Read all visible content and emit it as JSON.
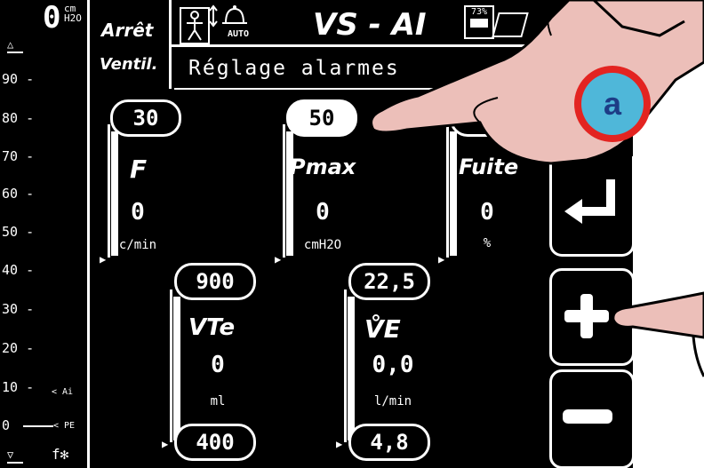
{
  "scale": {
    "top_value": "0",
    "unit": "cm H2O",
    "ticks": [
      "90 -",
      "80 -",
      "70 -",
      "60 -",
      "50 -",
      "40 -",
      "30 -",
      "20 -",
      "10 -",
      "0"
    ],
    "marker_ai": "< Ai",
    "marker_pe": "< PE"
  },
  "header": {
    "stop_line1": "Arrêt",
    "stop_line2": "Ventil.",
    "auto_label": "AUTO",
    "mode": "VS - AI",
    "battery_percent": "73%",
    "subtitle": "Réglage alarmes"
  },
  "params": [
    {
      "name": "F",
      "setting": "30",
      "value": "0",
      "unit": "c/min"
    },
    {
      "name": "Pmax",
      "setting": "50",
      "value": "0",
      "unit": "cmH2O",
      "selected": true
    },
    {
      "name": "Fuite",
      "setting": "",
      "value": "0",
      "unit": "%"
    },
    {
      "name": "VTe",
      "setting_high": "900",
      "setting_low": "400",
      "value": "0",
      "unit": "ml"
    },
    {
      "name": "V̊E",
      "setting_high": "22,5",
      "setting_low": "4,8",
      "value": "0,0",
      "unit": "l/min"
    }
  ],
  "annotation": {
    "label": "a"
  },
  "colors": {
    "screen": "#000000",
    "fg": "#ffffff",
    "badge_ring": "#e32421",
    "badge_fill": "#4fb7d9",
    "badge_text": "#1d3c86",
    "skin": "#ecbfb9"
  },
  "icons": [
    "patient-icon",
    "alarm-bell-icon",
    "battery-icon",
    "return-arrow-icon",
    "plus-icon",
    "minus-icon"
  ]
}
